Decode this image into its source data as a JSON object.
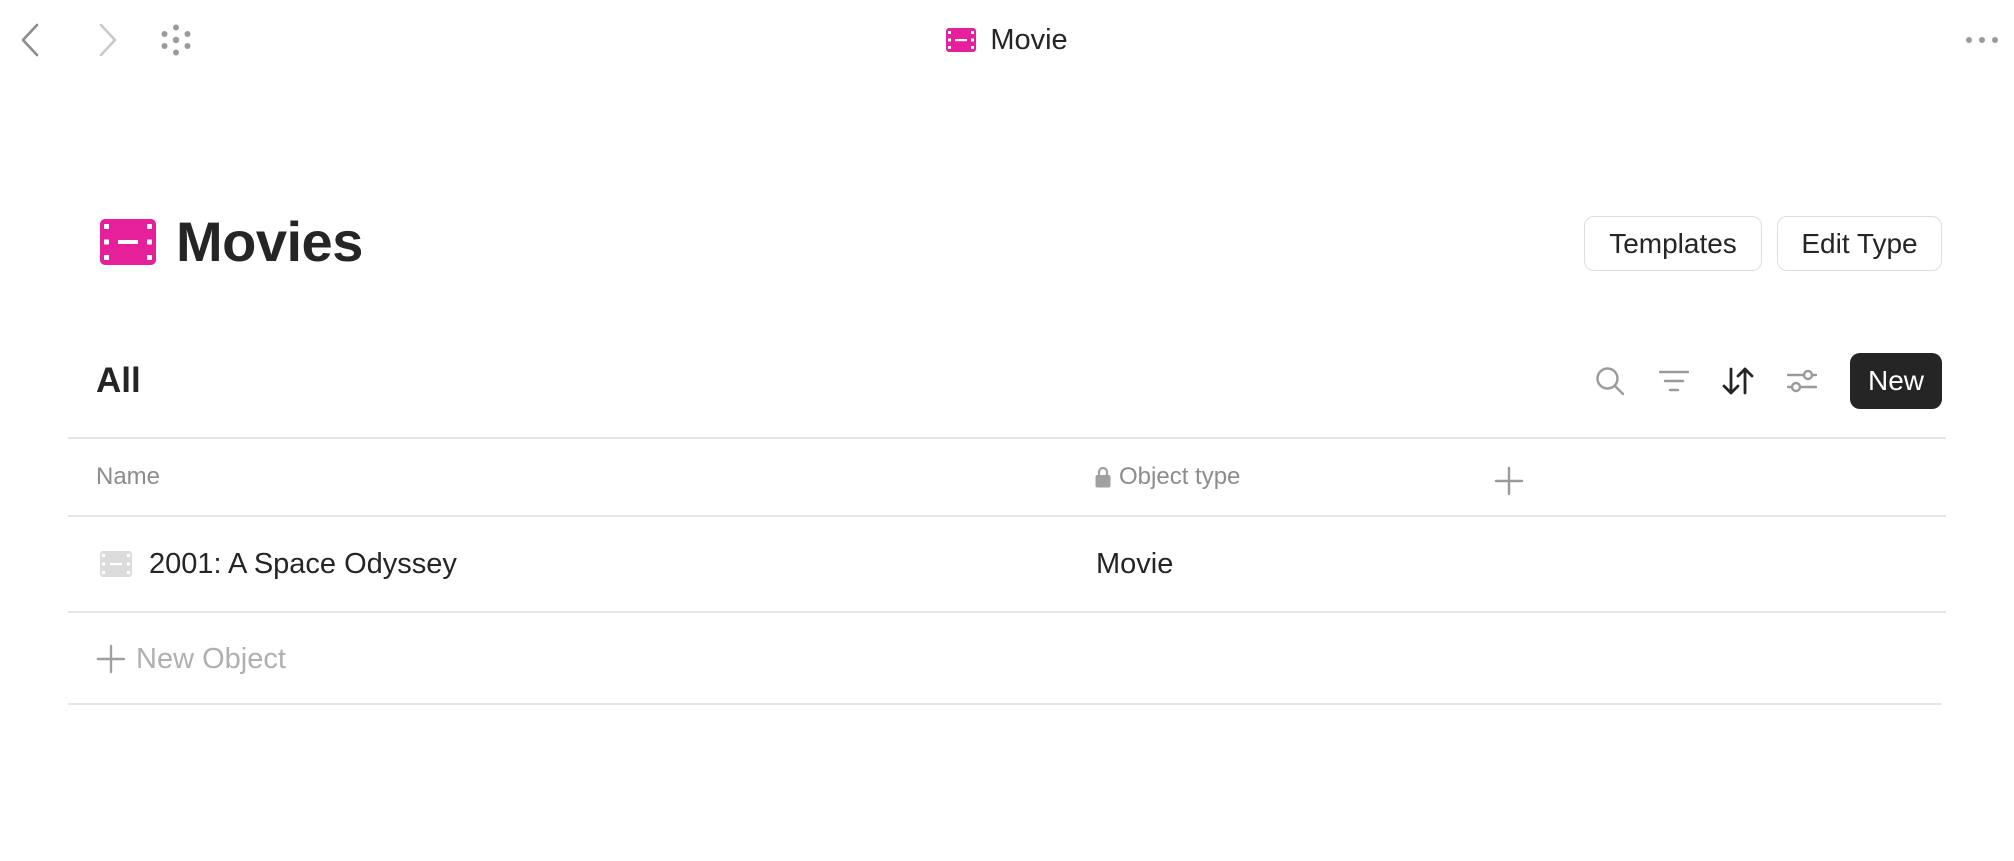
{
  "topbar": {
    "title": "Movie",
    "icons": {
      "back": "chevron-left-icon",
      "forward": "chevron-right-icon",
      "graph": "graph-dots-icon",
      "more": "more-horizontal-icon",
      "type": "film-icon"
    }
  },
  "header": {
    "title": "Movies",
    "icon": "film-icon",
    "templates_label": "Templates",
    "edit_type_label": "Edit Type"
  },
  "view": {
    "title": "All",
    "new_label": "New",
    "tools": [
      "search-icon",
      "filter-icon",
      "sort-icon",
      "settings-sliders-icon"
    ]
  },
  "table": {
    "columns": [
      {
        "label": "Name"
      },
      {
        "label": "Object type",
        "locked": true
      }
    ],
    "rows": [
      {
        "name": "2001: A Space Odyssey",
        "type": "Movie"
      }
    ],
    "new_object_label": "New Object"
  },
  "colors": {
    "accent": "#e6209b",
    "text": "#252525",
    "muted": "#8c8c8c",
    "faint": "#b0b0b0",
    "border": "#e6e6e6",
    "button_dark": "#252525"
  }
}
